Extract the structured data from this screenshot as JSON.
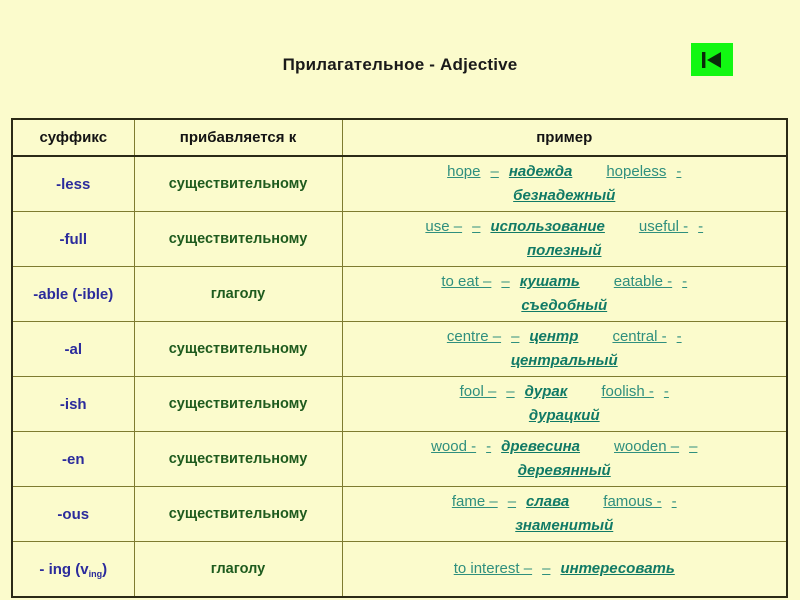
{
  "page": {
    "background_color": "#fbfbcc",
    "title": "Прилагательное - Adjective"
  },
  "header": {
    "title": "Прилагательное - Adjective",
    "back_button": {
      "icon": "skip-to-start-icon",
      "color": "#12f712",
      "glyph_color": "#0a2a0a",
      "label": ""
    }
  },
  "table": {
    "columns": [
      {
        "key": "suffix",
        "label": "суффикс"
      },
      {
        "key": "attaches",
        "label": "прибавляется к"
      },
      {
        "key": "example",
        "label": "пример"
      }
    ],
    "rows": [
      {
        "suffix": "-less",
        "suffix_sub": "",
        "attaches": "существительному",
        "example_line1": {
          "en1": "hope",
          "dash1": "–",
          "ru1": "надежда",
          "en2": "hopeless",
          "dash2": "-"
        },
        "example_line2": {
          "ru2": "безнадежный"
        }
      },
      {
        "suffix": "-full",
        "suffix_sub": "",
        "attaches": "существительному",
        "example_line1": {
          "en1": "use –",
          "dash1": "–",
          "ru1": "использование",
          "en2": "useful -",
          "dash2": "-"
        },
        "example_line2": {
          "ru2": "полезный"
        }
      },
      {
        "suffix": "-able (-ible)",
        "suffix_sub": "",
        "attaches": "глаголу",
        "example_line1": {
          "en1": "to eat –",
          "dash1": "–",
          "ru1": "кушать",
          "en2": "eatable -",
          "dash2": "-"
        },
        "example_line2": {
          "ru2": "съедобный"
        }
      },
      {
        "suffix": "-al",
        "suffix_sub": "",
        "attaches": "существительному",
        "example_line1": {
          "en1": "centre –",
          "dash1": "–",
          "ru1": "центр",
          "en2": "central -",
          "dash2": "-"
        },
        "example_line2": {
          "ru2": "центральный"
        }
      },
      {
        "suffix": "-ish",
        "suffix_sub": "",
        "attaches": "существительному",
        "example_line1": {
          "en1": "fool –",
          "dash1": "–",
          "ru1": "дурак",
          "en2": "foolish -",
          "dash2": "-"
        },
        "example_line2": {
          "ru2": "дурацкий"
        }
      },
      {
        "suffix": "-en",
        "suffix_sub": "",
        "attaches": "существительному",
        "example_line1": {
          "en1": "wood -",
          "dash1": "-",
          "ru1": "древесина",
          "en2": "wooden –",
          "dash2": "–"
        },
        "example_line2": {
          "ru2": "деревянный"
        }
      },
      {
        "suffix": "-ous",
        "suffix_sub": "",
        "attaches": "существительному",
        "example_line1": {
          "en1": "fame –",
          "dash1": "–",
          "ru1": "слава",
          "en2": "famous -",
          "dash2": "-"
        },
        "example_line2": {
          "ru2": "знаменитый"
        }
      },
      {
        "suffix": "- ing (v",
        "suffix_sub": "ing",
        "suffix_tail": ")",
        "attaches": "глаголу",
        "example_line1": {
          "en1": "to interest –",
          "dash1": "–",
          "ru1": "интересовать",
          "en2": "",
          "dash2": ""
        },
        "example_line2": {
          "ru2": ""
        }
      }
    ]
  },
  "colors": {
    "background": "#fbfbcc",
    "border": "#7e7b30",
    "border_outer": "#2b2a16",
    "suffix_text": "#2b2b9c",
    "attaches_text": "#1e5b1e",
    "example_en": "#2f8f7e",
    "example_ru": "#117a66",
    "title_text": "#1a1a1a",
    "accent_green": "#12f712"
  }
}
